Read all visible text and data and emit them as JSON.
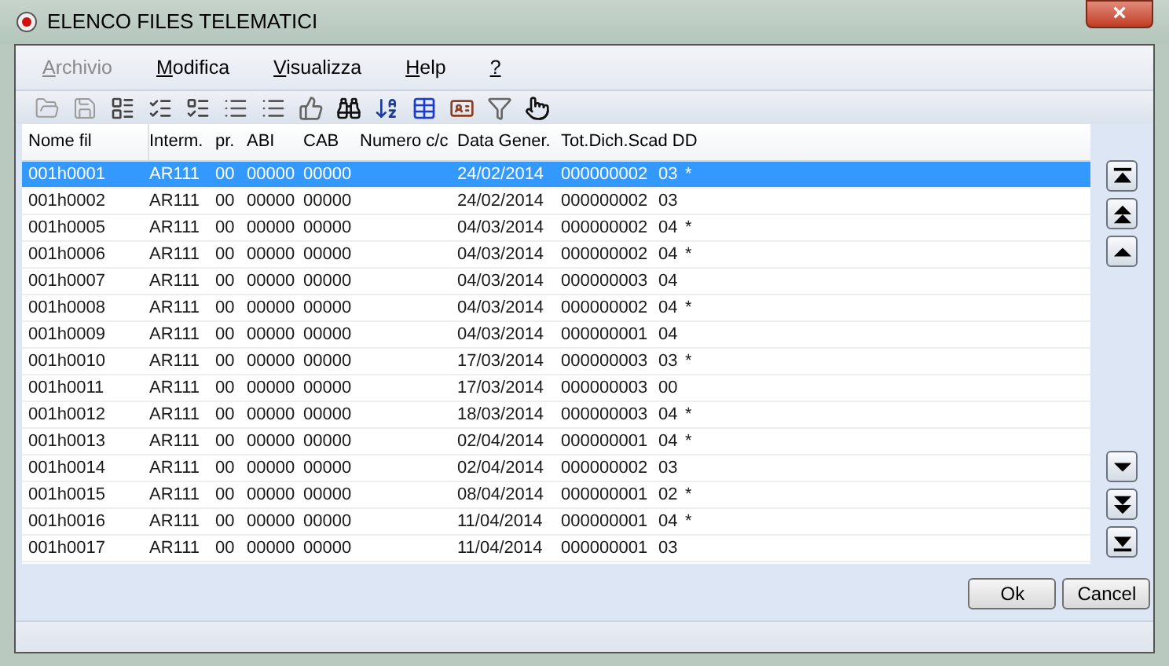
{
  "window": {
    "title": "ELENCO FILES TELEMATICI",
    "close": "×"
  },
  "menu": [
    {
      "label": "Archivio",
      "disabled": true
    },
    {
      "label": "Modifica",
      "disabled": false
    },
    {
      "label": "Visualizza",
      "disabled": false
    },
    {
      "label": "Help",
      "disabled": false
    },
    {
      "label": "?",
      "disabled": false
    }
  ],
  "toolbar": [
    {
      "kind": "open",
      "disabled": true
    },
    {
      "kind": "save",
      "disabled": true
    },
    {
      "kind": "form",
      "disabled": false
    },
    {
      "kind": "checklist",
      "disabled": false
    },
    {
      "kind": "checkboxes",
      "disabled": false
    },
    {
      "kind": "list",
      "disabled": false
    },
    {
      "kind": "list",
      "disabled": false
    },
    {
      "kind": "thumb",
      "disabled": false
    },
    {
      "kind": "binoculars",
      "disabled": false
    },
    {
      "kind": "sort",
      "disabled": false
    },
    {
      "kind": "table",
      "disabled": false
    },
    {
      "kind": "card",
      "disabled": false
    },
    {
      "kind": "filter",
      "disabled": false
    },
    {
      "kind": "hand",
      "disabled": false
    }
  ],
  "table": {
    "columns": [
      "Nome fil",
      "Interm.",
      "pr.",
      "ABI",
      "CAB",
      "Numero c/c",
      "Data Gener.",
      "Tot.Dich.Scad DD"
    ],
    "rows": [
      {
        "cells": [
          "001h0001",
          "AR111",
          "00",
          "00000",
          "00000",
          "",
          "24/02/2014",
          "000000002",
          "03",
          "*"
        ],
        "selected": true
      },
      {
        "cells": [
          "001h0002",
          "AR111",
          "00",
          "00000",
          "00000",
          "",
          "24/02/2014",
          "000000002",
          "03",
          ""
        ],
        "selected": false
      },
      {
        "cells": [
          "001h0005",
          "AR111",
          "00",
          "00000",
          "00000",
          "",
          "04/03/2014",
          "000000002",
          "04",
          "*"
        ],
        "selected": false
      },
      {
        "cells": [
          "001h0006",
          "AR111",
          "00",
          "00000",
          "00000",
          "",
          "04/03/2014",
          "000000002",
          "04",
          "*"
        ],
        "selected": false
      },
      {
        "cells": [
          "001h0007",
          "AR111",
          "00",
          "00000",
          "00000",
          "",
          "04/03/2014",
          "000000003",
          "04",
          ""
        ],
        "selected": false
      },
      {
        "cells": [
          "001h0008",
          "AR111",
          "00",
          "00000",
          "00000",
          "",
          "04/03/2014",
          "000000002",
          "04",
          "*"
        ],
        "selected": false
      },
      {
        "cells": [
          "001h0009",
          "AR111",
          "00",
          "00000",
          "00000",
          "",
          "04/03/2014",
          "000000001",
          "04",
          ""
        ],
        "selected": false
      },
      {
        "cells": [
          "001h0010",
          "AR111",
          "00",
          "00000",
          "00000",
          "",
          "17/03/2014",
          "000000003",
          "03",
          "*"
        ],
        "selected": false
      },
      {
        "cells": [
          "001h0011",
          "AR111",
          "00",
          "00000",
          "00000",
          "",
          "17/03/2014",
          "000000003",
          "00",
          ""
        ],
        "selected": false
      },
      {
        "cells": [
          "001h0012",
          "AR111",
          "00",
          "00000",
          "00000",
          "",
          "18/03/2014",
          "000000003",
          "04",
          "*"
        ],
        "selected": false
      },
      {
        "cells": [
          "001h0013",
          "AR111",
          "00",
          "00000",
          "00000",
          "",
          "02/04/2014",
          "000000001",
          "04",
          "*"
        ],
        "selected": false
      },
      {
        "cells": [
          "001h0014",
          "AR111",
          "00",
          "00000",
          "00000",
          "",
          "02/04/2014",
          "000000002",
          "03",
          ""
        ],
        "selected": false
      },
      {
        "cells": [
          "001h0015",
          "AR111",
          "00",
          "00000",
          "00000",
          "",
          "08/04/2014",
          "000000001",
          "02",
          "*"
        ],
        "selected": false
      },
      {
        "cells": [
          "001h0016",
          "AR111",
          "00",
          "00000",
          "00000",
          "",
          "11/04/2014",
          "000000001",
          "04",
          "*"
        ],
        "selected": false
      },
      {
        "cells": [
          "001h0017",
          "AR111",
          "00",
          "00000",
          "00000",
          "",
          "11/04/2014",
          "000000001",
          "03",
          ""
        ],
        "selected": false
      }
    ]
  },
  "nav_top": [
    {
      "kind": "first"
    },
    {
      "kind": "page-up"
    },
    {
      "kind": "up"
    }
  ],
  "nav_bottom": [
    {
      "kind": "down"
    },
    {
      "kind": "page-down"
    },
    {
      "kind": "last"
    }
  ],
  "buttons": [
    "Ok",
    "Cancel"
  ]
}
